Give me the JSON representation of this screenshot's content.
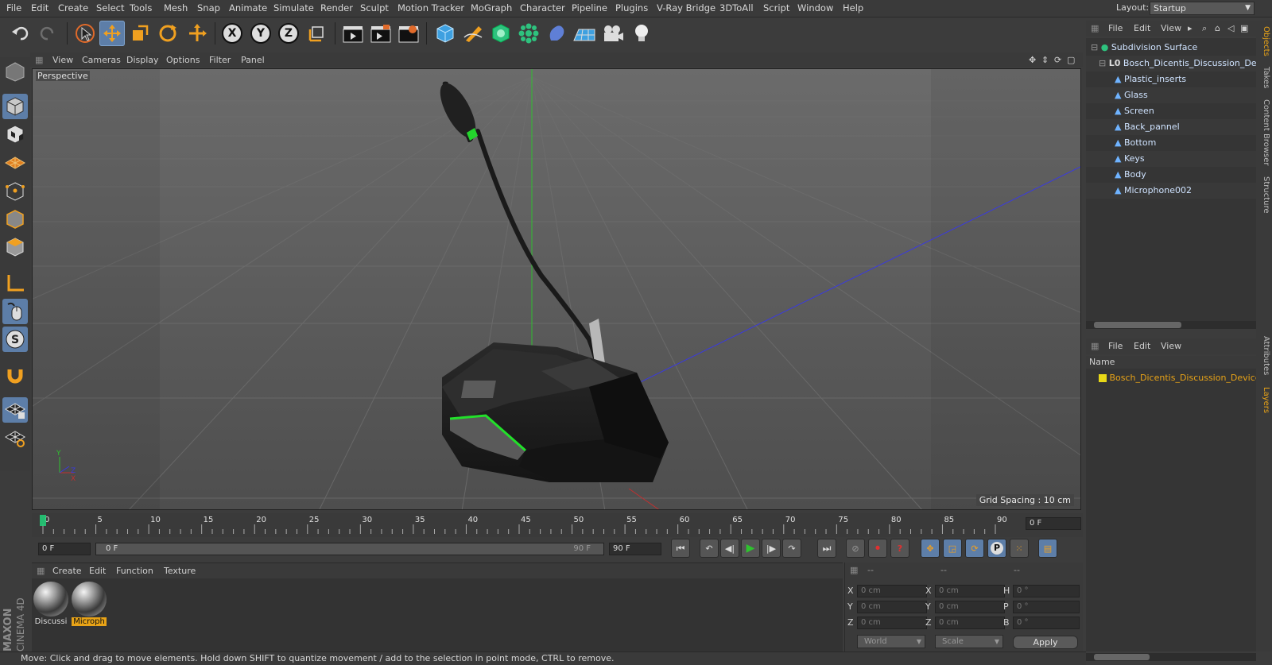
{
  "menubar": {
    "items": [
      "File",
      "Edit",
      "Create",
      "Select",
      "Tools",
      "Mesh",
      "Snap",
      "Animate",
      "Simulate",
      "Render",
      "Sculpt",
      "Motion Tracker",
      "MoGraph",
      "Character",
      "Pipeline",
      "Plugins",
      "V-Ray Bridge",
      "3DToAll",
      "Script",
      "Window",
      "Help"
    ],
    "layout_label": "Layout:",
    "layout_value": "Startup"
  },
  "toolbar": {
    "axis_x": "X",
    "axis_y": "Y",
    "axis_z": "Z"
  },
  "viewport": {
    "menu": [
      "View",
      "Cameras",
      "Display",
      "Options",
      "Filter",
      "Panel"
    ],
    "camera_label": "Perspective",
    "grid_spacing": "Grid Spacing : 10 cm"
  },
  "timeline": {
    "ticks": [
      "0",
      "5",
      "10",
      "15",
      "20",
      "25",
      "30",
      "35",
      "40",
      "45",
      "50",
      "55",
      "60",
      "65",
      "70",
      "75",
      "80",
      "85",
      "90"
    ],
    "current_frame_right": "0 F",
    "start_field": "0 F",
    "range_start": "0 F",
    "range_end": "90 F",
    "end_field": "90 F",
    "playhead_fraction": 0
  },
  "materials": {
    "menu": [
      "Create",
      "Edit",
      "Function",
      "Texture"
    ],
    "items": [
      {
        "label": "Discussi",
        "selected": false
      },
      {
        "label": "Microph",
        "selected": true
      }
    ]
  },
  "coords": {
    "headers": [
      "--",
      "--",
      "--"
    ],
    "rows": [
      {
        "l1": "X",
        "v1": "0 cm",
        "l2": "X",
        "v2": "0 cm",
        "l3": "H",
        "v3": "0 °"
      },
      {
        "l1": "Y",
        "v1": "0 cm",
        "l2": "Y",
        "v2": "0 cm",
        "l3": "P",
        "v3": "0 °"
      },
      {
        "l1": "Z",
        "v1": "0 cm",
        "l2": "Z",
        "v2": "0 cm",
        "l3": "B",
        "v3": "0 °"
      }
    ],
    "space": "World",
    "mode": "Scale",
    "apply": "Apply"
  },
  "status": "Move: Click and drag to move elements. Hold down SHIFT to quantize movement / add to the selection in point mode, CTRL to remove.",
  "brand": {
    "maxon": "MAXON",
    "product": "CINEMA 4D"
  },
  "objects_panel": {
    "menu": [
      "File",
      "Edit",
      "View"
    ],
    "tree": [
      {
        "label": "Subdivision Surface",
        "depth": 0
      },
      {
        "label": "Bosch_Dicentis_Discussion_Device",
        "depth": 1
      },
      {
        "label": "Plastic_inserts",
        "depth": 2
      },
      {
        "label": "Glass",
        "depth": 2
      },
      {
        "label": "Screen",
        "depth": 2
      },
      {
        "label": "Back_pannel",
        "depth": 2
      },
      {
        "label": "Bottom",
        "depth": 2
      },
      {
        "label": "Keys",
        "depth": 2
      },
      {
        "label": "Body",
        "depth": 2
      },
      {
        "label": "Microphone002",
        "depth": 2
      }
    ]
  },
  "layers_panel": {
    "menu": [
      "File",
      "Edit",
      "View"
    ],
    "column": "Name",
    "items": [
      "Bosch_Dicentis_Discussion_Device"
    ]
  },
  "side_tabs": [
    "Objects",
    "Takes",
    "Content Browser",
    "Structure",
    "Attributes",
    "Layers"
  ],
  "colors": {
    "accent": "#e8a317",
    "highlight": "#5d7ea8",
    "tree_text": "#cfe3ff"
  }
}
